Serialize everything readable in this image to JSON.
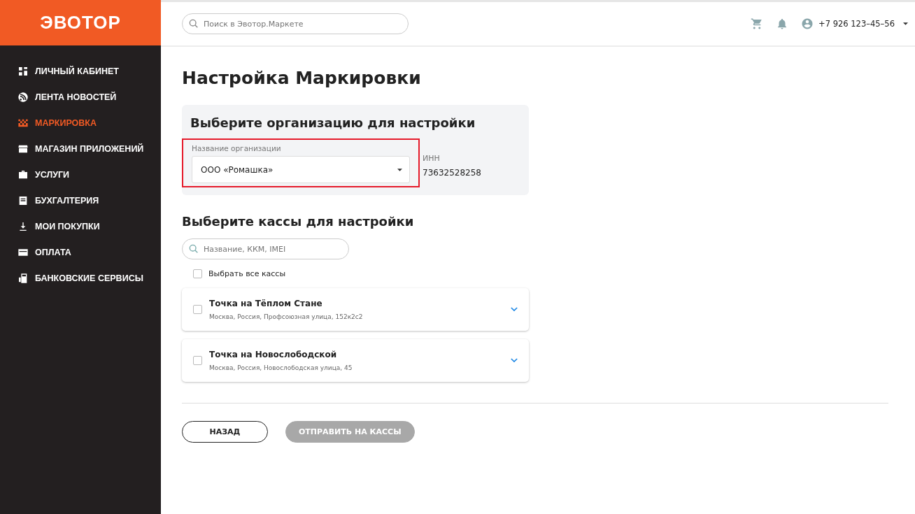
{
  "logo": "ЭВОТОР",
  "sidebar": {
    "items": [
      {
        "label": "ЛИЧНЫЙ КАБИНЕТ",
        "selected": false
      },
      {
        "label": "ЛЕНТА НОВОСТЕЙ",
        "selected": false
      },
      {
        "label": "МАРКИРОВКА",
        "selected": true
      },
      {
        "label": "МАГАЗИН ПРИЛОЖЕНИЙ",
        "selected": false
      },
      {
        "label": "УСЛУГИ",
        "selected": false
      },
      {
        "label": "БУХГАЛТЕРИЯ",
        "selected": false
      },
      {
        "label": "МОИ ПОКУПКИ",
        "selected": false
      },
      {
        "label": "ОПЛАТА",
        "selected": false
      },
      {
        "label": "БАНКОВСКИЕ СЕРВИСЫ",
        "selected": false
      }
    ]
  },
  "topbar": {
    "search": {
      "placeholder": "Поиск в Эвотор.Маркете"
    },
    "phone": "+7 926 123–45–56"
  },
  "page_title": "Настройка Маркировки",
  "organization": {
    "heading": "Выберите организацию для настройки",
    "field_label": "Название организации",
    "value": "ООО «Ромашка»",
    "highlighted": true,
    "inn_label": "ИНН",
    "inn": "73632528258"
  },
  "registers": {
    "heading": "Выберите кассы для настройки",
    "search": {
      "placeholder": "Название, ККМ, IMEI"
    },
    "select_all": {
      "label": "Выбрать все кассы",
      "checked": false
    },
    "items": [
      {
        "name": "Точка на Тёплом Стане",
        "address": "Москва, Россия, Профсоюзная улица, 152к2с2",
        "checked": false,
        "expanded": false
      },
      {
        "name": "Точка на Новослободской",
        "address": "Москва, Россия, Новослободская улица, 45",
        "checked": false,
        "expanded": false
      }
    ]
  },
  "buttons": [
    {
      "label": "НАЗАД",
      "disabled": false
    },
    {
      "label": "ОТПРАВИТЬ НА КАССЫ",
      "disabled": true
    }
  ]
}
